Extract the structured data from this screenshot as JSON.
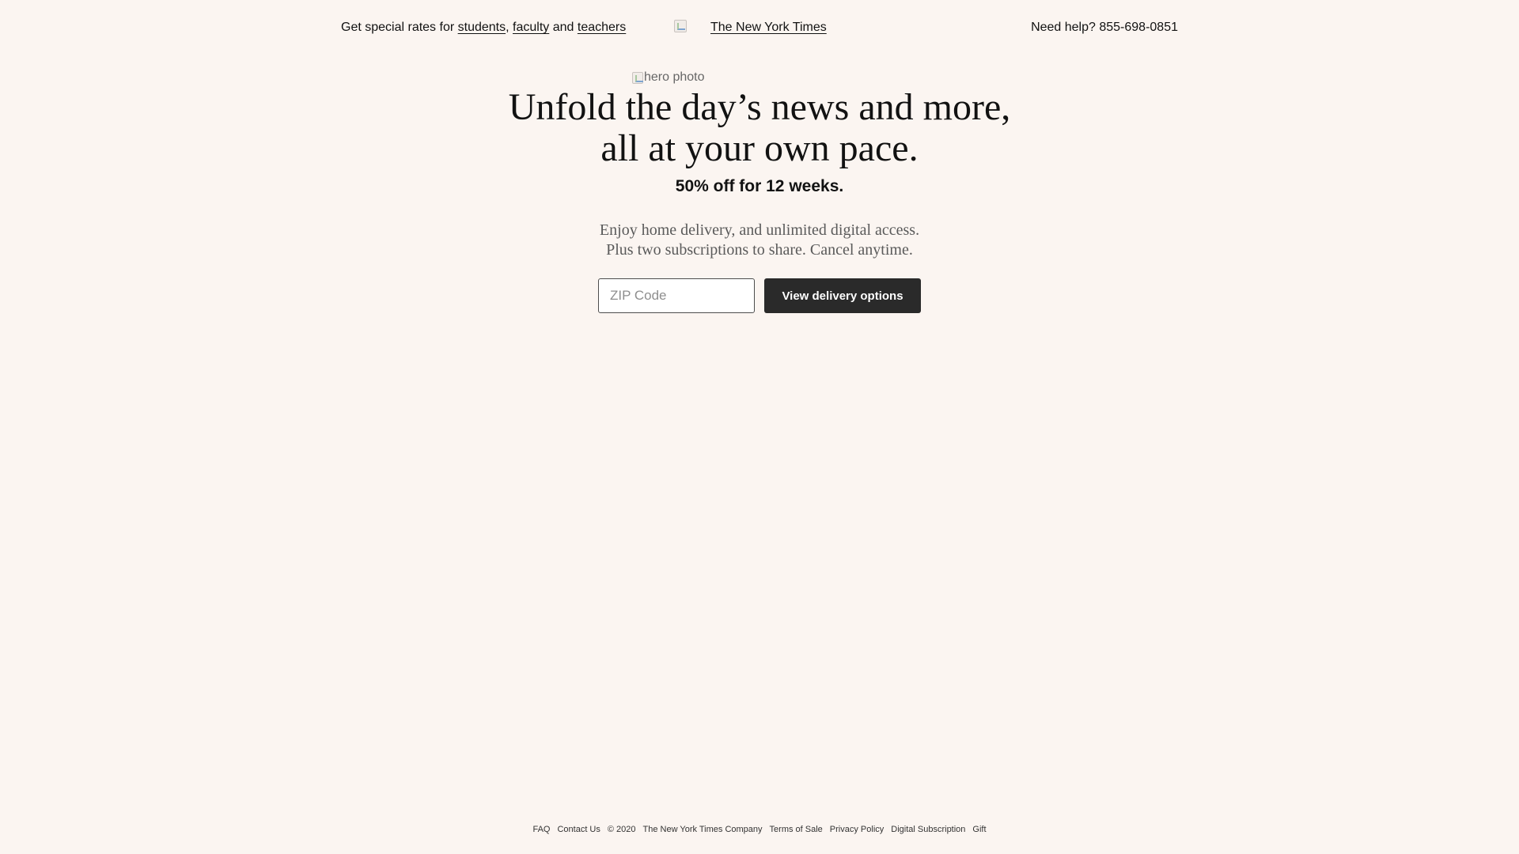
{
  "header": {
    "rates_prefix": "Get special rates for",
    "links": {
      "students": "students",
      "faculty": "faculty",
      "teachers": "teachers"
    },
    "comma": ",",
    "and": "and",
    "logo_text": "The New York Times",
    "help_text": "Need help? 855-698-0851"
  },
  "hero": {
    "image_alt": "hero photo",
    "headline_line1": "Unfold the day’s news and more,",
    "headline_line2": "all at your own pace.",
    "offer": "50% off for 12 weeks.",
    "sub_line1": "Enjoy home delivery, and unlimited digital access.",
    "sub_line2": "Plus two subscriptions to share. Cancel anytime."
  },
  "form": {
    "zip_placeholder": "ZIP Code",
    "zip_value": "",
    "button_label": "View delivery options"
  },
  "footer": {
    "links": [
      "FAQ",
      "Contact Us",
      "© 2020",
      "The New York Times Company",
      "Terms of Sale",
      "Privacy Policy",
      "Digital Subscription",
      "Gift"
    ]
  },
  "colors": {
    "background": "#fbf5f1",
    "button": "#2a2a2a",
    "text": "#121212"
  }
}
